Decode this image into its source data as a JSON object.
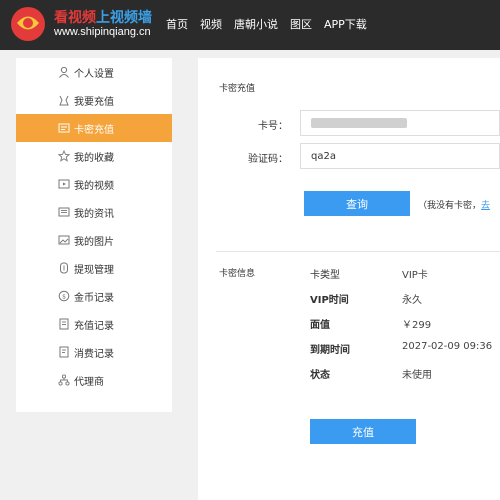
{
  "header": {
    "logo_text_a": "看视频",
    "logo_text_b": "上视频墙",
    "logo_url": "www.shipinqiang.cn",
    "nav": [
      "首页",
      "视频",
      "唐朝小说",
      "图区",
      "APP下载"
    ],
    "colors": {
      "bar": "#2b2b2b",
      "logo_red": "#e33a3a",
      "logo_blue": "#3aa0e8"
    }
  },
  "sidebar": {
    "items": [
      {
        "label": "个人设置",
        "icon": "user-icon"
      },
      {
        "label": "我要充值",
        "icon": "wallet-icon"
      },
      {
        "label": "卡密充值",
        "icon": "card-icon",
        "active": true
      },
      {
        "label": "我的收藏",
        "icon": "star-icon"
      },
      {
        "label": "我的视频",
        "icon": "video-icon"
      },
      {
        "label": "我的资讯",
        "icon": "news-icon"
      },
      {
        "label": "我的图片",
        "icon": "image-icon"
      },
      {
        "label": "提现管理",
        "icon": "withdraw-icon"
      },
      {
        "label": "金币记录",
        "icon": "coin-icon"
      },
      {
        "label": "充值记录",
        "icon": "recharge-record-icon"
      },
      {
        "label": "消费记录",
        "icon": "consume-record-icon"
      },
      {
        "label": "代理商",
        "icon": "agent-icon"
      }
    ],
    "active_color": "#f5a33b"
  },
  "recharge": {
    "section_title": "卡密充值",
    "card_label": "卡号：",
    "card_value": "",
    "captcha_label": "验证码：",
    "captcha_value": "qa2a",
    "query_button": "查询",
    "hint_prefix": "（我没有卡密，",
    "hint_link": "去"
  },
  "card_info": {
    "section_title": "卡密信息",
    "rows": [
      {
        "key": "卡类型",
        "value": "VIP卡"
      },
      {
        "key": "VIP时间",
        "value": "永久"
      },
      {
        "key": "面值",
        "value": "￥299"
      },
      {
        "key": "到期时间",
        "value": "2027-02-09 09:36"
      },
      {
        "key": "状态",
        "value": "未使用"
      }
    ],
    "recharge_button": "充值"
  },
  "accent": "#3a9bf0"
}
